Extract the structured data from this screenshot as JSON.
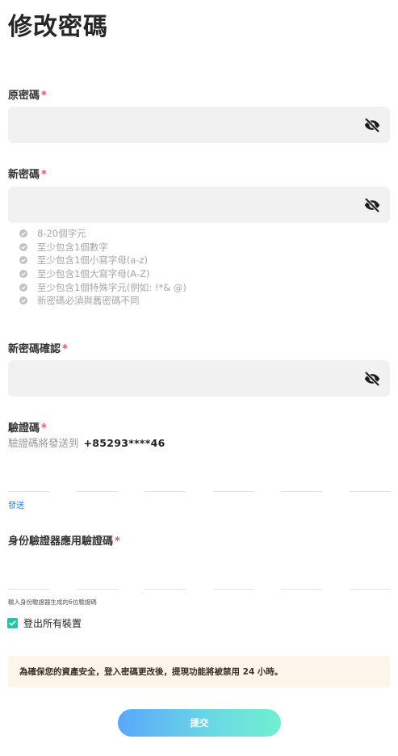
{
  "header": {
    "title": "修改密碼"
  },
  "required_mark": "*",
  "old_password": {
    "label": "原密碼",
    "value": ""
  },
  "new_password": {
    "label": "新密碼",
    "value": "",
    "rules": [
      "8-20個字元",
      "至少包含1個數字",
      "至少包含1個小寫字母(a-z)",
      "至少包含1個大寫字母(A-Z)",
      "至少包含1個特殊字元(例如: !*& @)",
      "新密碼必須與舊密碼不同"
    ]
  },
  "confirm_password": {
    "label": "新密碼確認",
    "value": ""
  },
  "verification": {
    "label": "驗證碼",
    "sub_prefix": "驗證碼將發送到",
    "phone": "+85293****46",
    "send_label": "發送",
    "digits": [
      "",
      "",
      "",
      "",
      "",
      ""
    ]
  },
  "authenticator": {
    "label": "身份驗證器應用驗證碼",
    "hint": "輸入身份驗證器生成的6位驗證碼",
    "digits": [
      "",
      "",
      "",
      "",
      "",
      ""
    ]
  },
  "logout_all": {
    "label": "登出所有裝置",
    "checked": true
  },
  "notice": {
    "text": "為確保您的資產安全，登入密碼更改後，提現功能將被禁用 24 小時。"
  },
  "submit": {
    "label": "提交"
  },
  "colors": {
    "accent": "#1dc8a4",
    "link": "#2f7fe0",
    "required": "#e25555",
    "notice_bg": "#fdf5ea"
  }
}
